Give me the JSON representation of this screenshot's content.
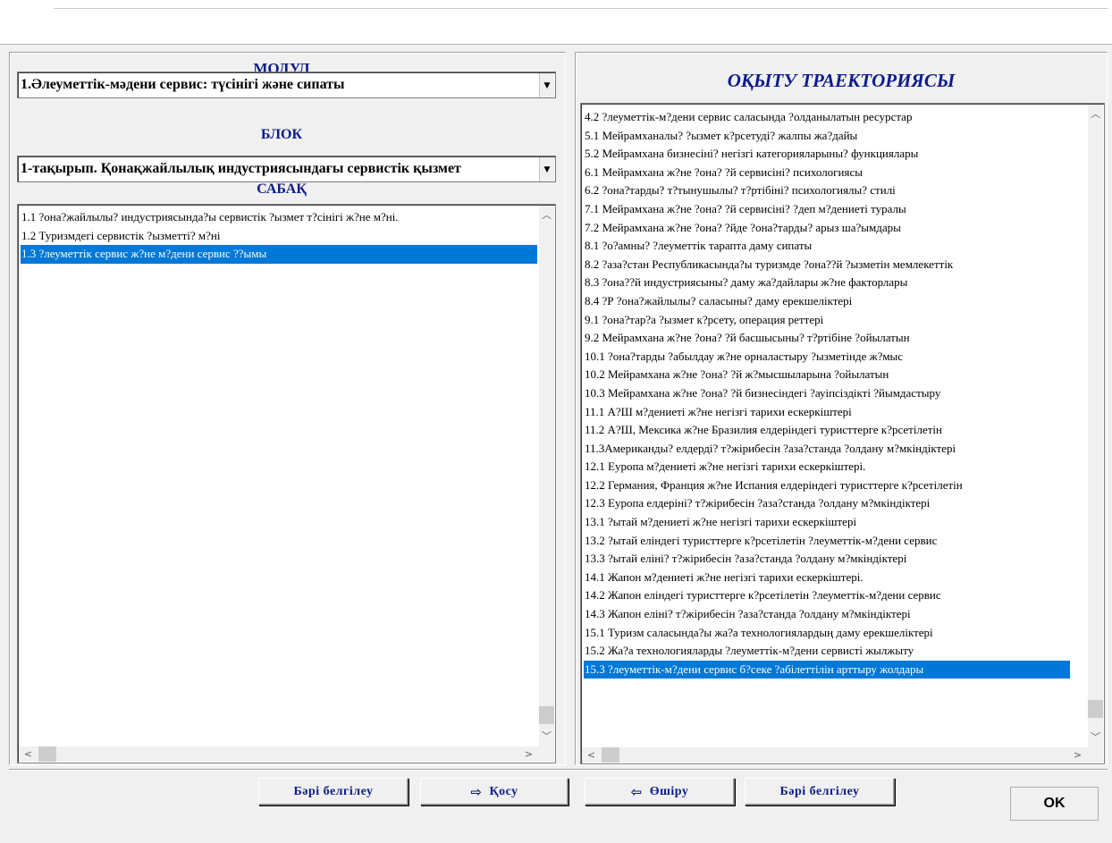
{
  "module": {
    "title": "МОДУЛ",
    "selected": "1.Әлеуметтік-мәдени сервис: түсінігі және сипаты"
  },
  "block": {
    "title": "БЛОК",
    "selected": "1-тақырып. Қонақжайлылық индустриясындағы сервистік қызмет"
  },
  "lesson": {
    "title": "САБАҚ",
    "items": [
      "1.1 ?она?жайлылы? индустриясында?ы сервистік ?ызмет т?сінігі ж?не м?ні.",
      "1.2 Туризмдегі сервистік ?ызметті? м?ні",
      "1.3 ?леуметтік сервис ж?не м?дени сервис ??ымы"
    ],
    "selected_index": 2
  },
  "trajectory": {
    "title": "ОҚЫТУ ТРАЕКТОРИЯСЫ",
    "items": [
      "4.2 ?леуметтік-м?дени сервис саласында ?олданылатын ресурстар",
      "5.1 Мейрамханалы? ?ызмет к?рсетуді? жалпы жа?дайы",
      "5.2 Мейрамхана бизнесіні? негізгі категорияларыны? функциялары",
      "6.1 Мейрамхана ж?не ?она? ?й сервисіні? психологиясы",
      "6.2 ?она?тарды? т?тынушылы? т?ртібіні? психологиялы? стилі",
      "7.1 Мейрамхана ж?не ?она? ?й сервисіні? ?деп м?дениеті туралы",
      "7.2 Мейрамхана ж?не ?она? ?йде ?она?тарды? арыз ша?ымдары",
      "8.1 ?о?амны? ?леуметтік тарапта даму сипаты",
      "8.2 ?аза?стан Республикасында?ы туризмде ?она??й ?ызметін мемлекеттік",
      "8.3 ?она??й индустриясыны? даму жа?дайлары ж?не факторлары",
      "8.4 ?Р ?она?жайлылы? саласыны? даму ерекшеліктері",
      "9.1 ?она?тар?а ?ызмет к?рсету, операция реттері",
      "9.2 Мейрамхана ж?не ?она? ?й басшысыны? т?ртібіне ?ойылатын",
      "10.1 ?она?тарды ?абылдау ж?не орналастыру ?ызметінде ж?мыс",
      "10.2 Мейрамхана ж?не ?она? ?й ж?мысшыларына ?ойылатын",
      "10.3 Мейрамхана ж?не ?она? ?й бизнесіндегі ?ауіпсіздікті ?йымдастыру",
      "11.1 А?Ш м?дениеті ж?не негізгі тарихи ескеркіштері",
      "11.2 А?Ш, Мексика ж?не Бразилия елдеріндегі туристтерге к?рсетілетін",
      "11.3Американды? елдерді? т?жірибесін ?аза?станда ?олдану м?мкіндіктері",
      "12.1 Еуропа м?дениеті ж?не негізгі тарихи ескеркіштері.",
      "12.2 Германия, Франция ж?не Испания елдеріндегі туристтерге к?рсетілетін",
      "12.3 Еуропа елдеріні? т?жірибесін ?аза?станда ?олдану м?мкіндіктері",
      "13.1 ?ытай м?дениеті ж?не негізгі тарихи ескеркіштері",
      "13.2 ?ытай еліндегі туристтерге к?рсетілетін ?леуметтік-м?дени сервис",
      "13.3 ?ытай елінi? т?жірибесін ?аза?станда ?олдану м?мкіндіктері",
      "14.1 Жапон м?дениеті ж?не негізгі тарихи ескеркіштері.",
      "14.2 Жапон еліндегі туристтерге к?рсетілетін ?леуметтік-м?дени сервис",
      "14.3 Жапон елінi? т?жірибесін ?аза?станда ?олдану м?мкіндіктері",
      "15.1 Туризм саласында?ы жа?а технологиялардың даму ерекшеліктері",
      "15.2 Жа?а технологияларды ?леуметтік-м?дени сервисті жылжыту",
      "15.3 ?леуметтік-м?дени сервис б?секе ?абілеттілін арттыру жолдары"
    ],
    "selected_index": 30
  },
  "buttons": {
    "select_all_left": "Бәрі белгілеу",
    "add": "Қосу",
    "remove": "Өшіру",
    "select_all_right": "Бәрі белгілеу",
    "ok": "OK"
  },
  "icons": {
    "dropdown": "dropdown-arrow-icon",
    "add": "arrow-right-icon",
    "remove": "arrow-left-icon"
  },
  "colors": {
    "title_blue": "#0b1c8c",
    "selection": "#0078d7"
  }
}
